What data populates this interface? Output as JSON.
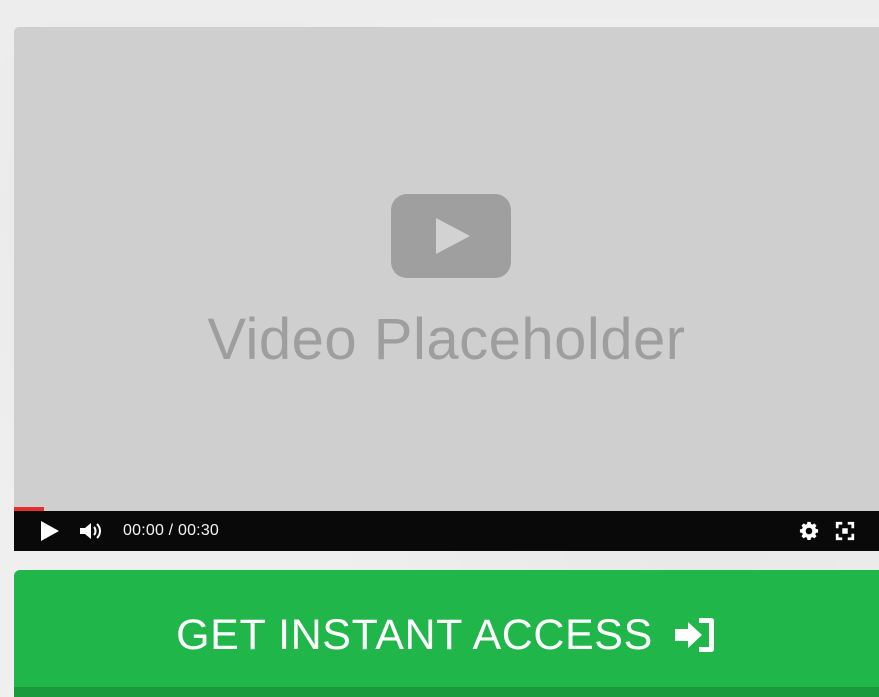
{
  "video": {
    "title": "Video Placeholder",
    "time": "00:00 / 00:30",
    "progress_percent": 3.5,
    "controls": {
      "play_icon": "play-icon",
      "volume_icon": "volume-icon",
      "settings_icon": "gear-icon",
      "fullscreen_icon": "fullscreen-icon"
    }
  },
  "cta": {
    "label": "GET INSTANT ACCESS",
    "icon": "sign-in-icon"
  },
  "colors": {
    "video_bg": "#cfcfcf",
    "controls_bg": "#090909",
    "progress": "#e3302f",
    "cta_bg": "#20b64a"
  }
}
